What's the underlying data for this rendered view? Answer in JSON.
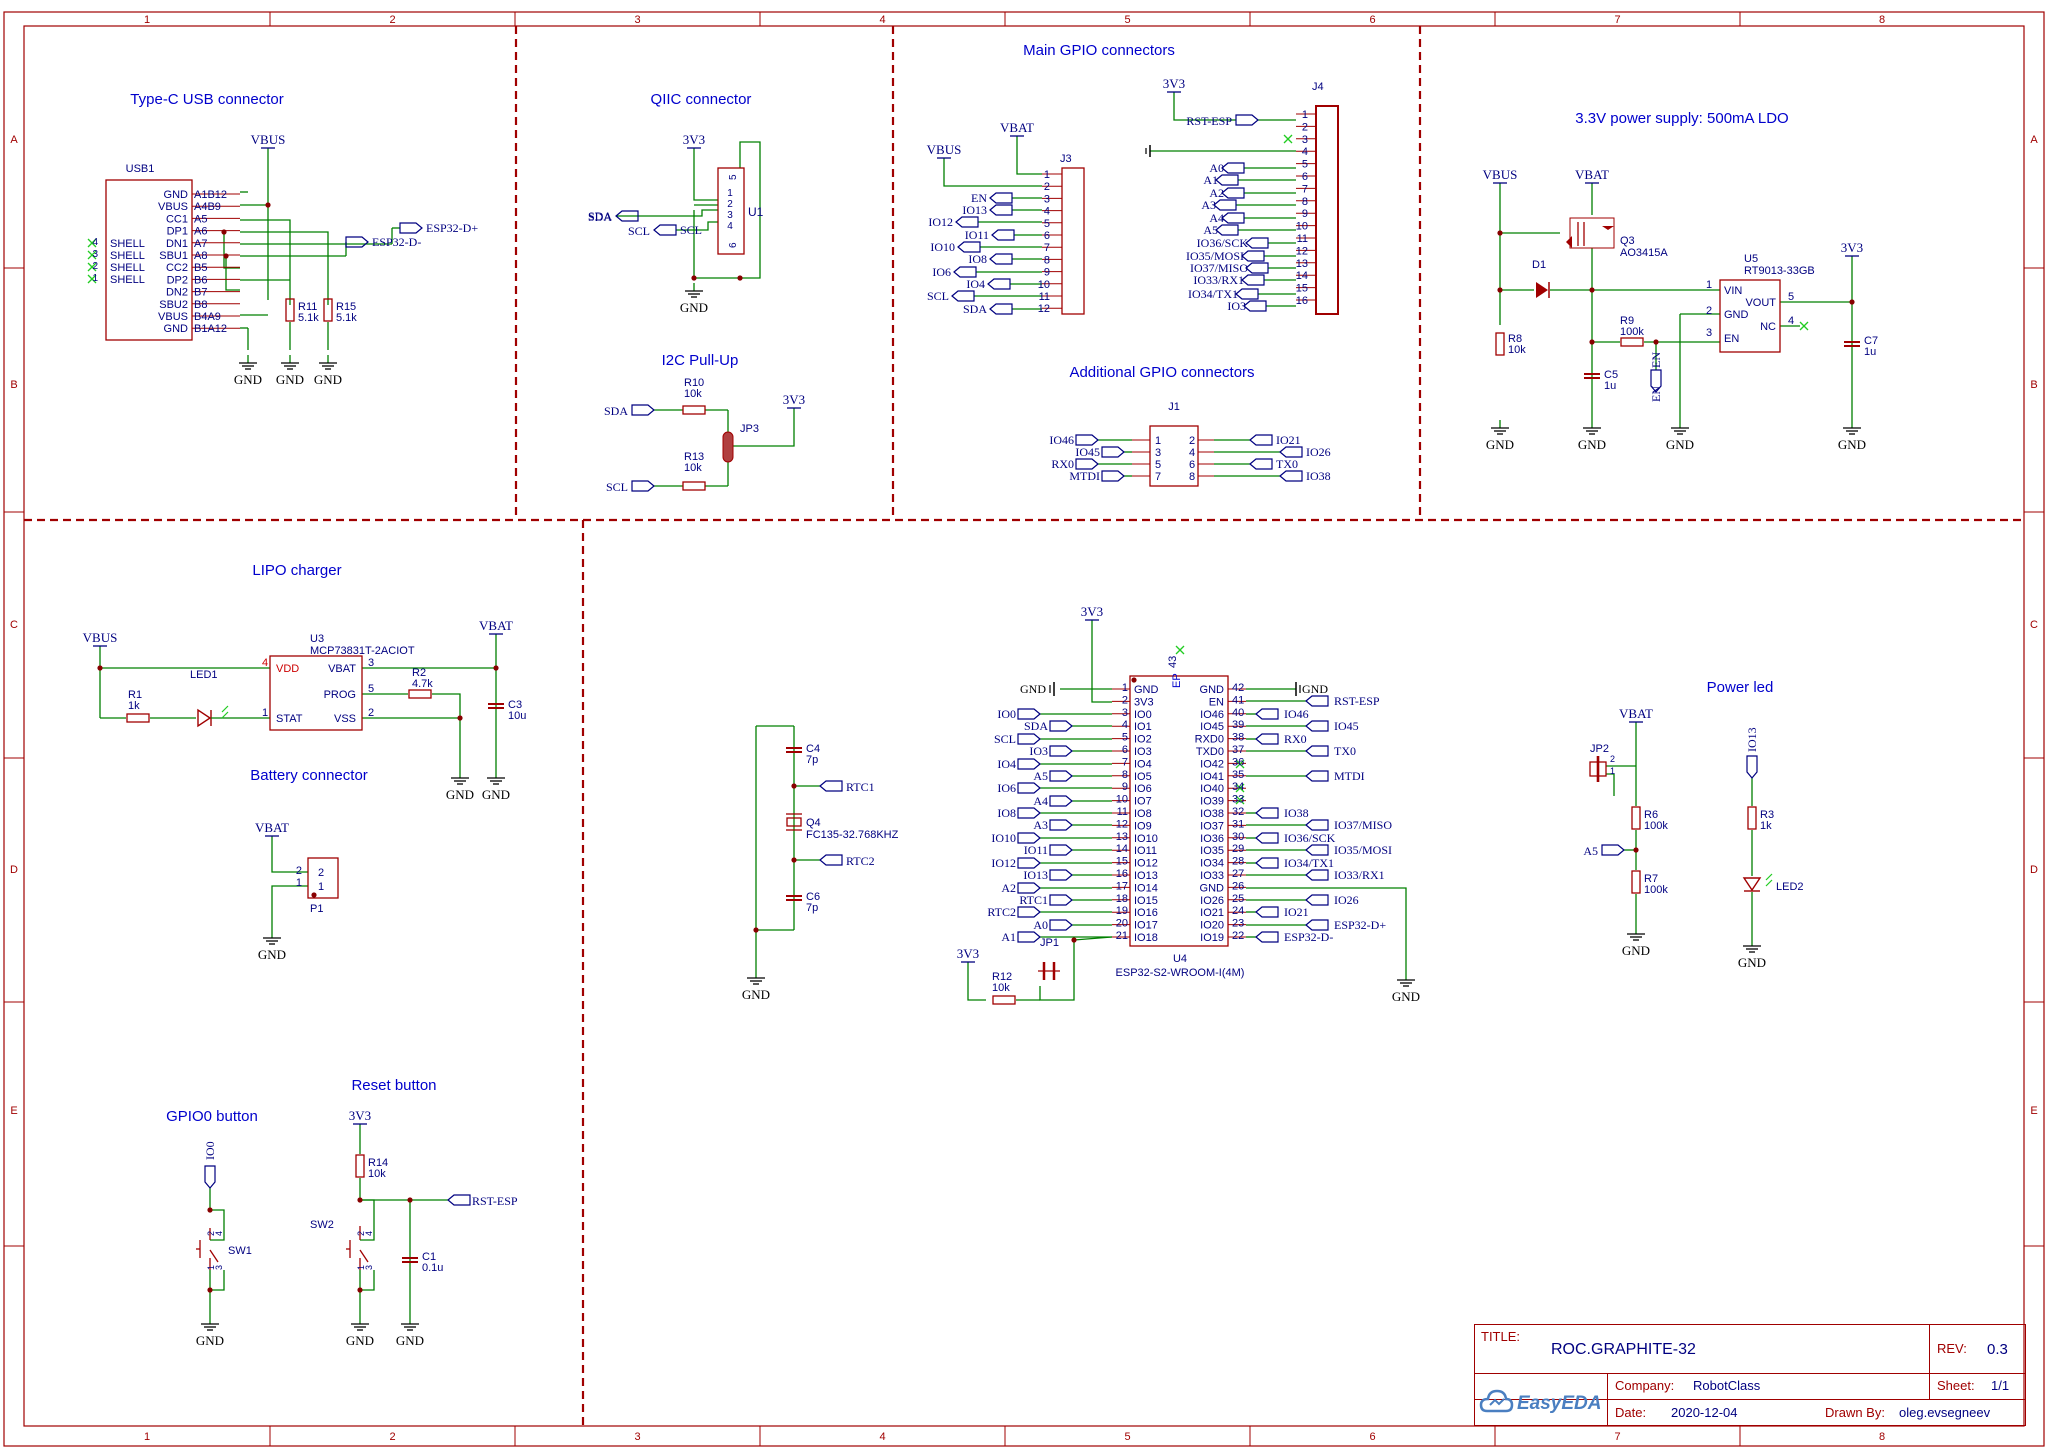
{
  "sheet": {
    "col_labels": [
      "1",
      "2",
      "3",
      "4",
      "5",
      "6",
      "7",
      "8"
    ],
    "row_labels": [
      "A",
      "B",
      "C",
      "D",
      "E"
    ]
  },
  "sections": {
    "usb": "Type-C USB connector",
    "qiic": "QIIC connector",
    "i2c_pullup": "I2C Pull-Up",
    "main_gpio": "Main GPIO connectors",
    "additional_gpio": "Additional GPIO connectors",
    "ldo": "3.3V power supply: 500mA LDO",
    "lipo": "LIPO charger",
    "battery": "Battery connector",
    "gpio0": "GPIO0 button",
    "reset": "Reset button",
    "power_led": "Power led"
  },
  "usb1": {
    "ref": "USB1",
    "left_pins": [
      "SHELL",
      "SHELL",
      "SHELL",
      "SHELL"
    ],
    "left_nums": [
      "4",
      "3",
      "2",
      "1"
    ],
    "inner_pins": [
      "GND",
      "VBUS",
      "CC1",
      "DP1",
      "DN1",
      "SBU1",
      "CC2",
      "DP2",
      "DN2",
      "SBU2",
      "VBUS",
      "GND"
    ],
    "outer_pins": [
      "A1B12",
      "A4B9",
      "A5",
      "A6",
      "A7",
      "A8",
      "B5",
      "B6",
      "B7",
      "B8",
      "B4A9",
      "B1A12"
    ],
    "r11": {
      "ref": "R11",
      "val": "5.1k"
    },
    "r15": {
      "ref": "R15",
      "val": "5.1k"
    },
    "dp_net": "ESP32-D+",
    "dm_net": "ESP32-D-"
  },
  "qiic": {
    "ref": "U1",
    "pins": [
      "1",
      "2",
      "3",
      "4"
    ],
    "pins_rot": [
      "5",
      "6"
    ],
    "sda": "SDA",
    "scl": "SCL"
  },
  "pullup": {
    "r10": {
      "ref": "R10",
      "val": "10k"
    },
    "r13": {
      "ref": "R13",
      "val": "10k"
    },
    "jp3": "JP3",
    "sda": "SDA",
    "scl": "SCL"
  },
  "j3": {
    "ref": "J3",
    "pins": [
      "1",
      "2",
      "3",
      "4",
      "5",
      "6",
      "7",
      "8",
      "9",
      "10",
      "11",
      "12"
    ],
    "nets": [
      "EN",
      "IO13",
      "IO12",
      "IO11",
      "IO10",
      "IO8",
      "IO6",
      "IO4",
      "SCL",
      "SDA"
    ]
  },
  "j4": {
    "ref": "J4",
    "pins": [
      "1",
      "2",
      "3",
      "4",
      "5",
      "6",
      "7",
      "8",
      "9",
      "10",
      "11",
      "12",
      "13",
      "14",
      "15",
      "16"
    ],
    "nets": [
      "RST-ESP",
      "A0",
      "A1",
      "A2",
      "A3",
      "A4",
      "A5",
      "IO36/SCK",
      "IO35/MOSI",
      "IO37/MISO",
      "IO33/RX1",
      "IO34/TX1",
      "IO3"
    ]
  },
  "j1": {
    "ref": "J1",
    "left_pins": [
      "1",
      "3",
      "5",
      "7"
    ],
    "right_pins": [
      "2",
      "4",
      "6",
      "8"
    ],
    "left_nets": [
      "IO46",
      "IO45",
      "RX0",
      "MTDI"
    ],
    "right_nets": [
      "IO21",
      "IO26",
      "TX0",
      "IO38"
    ]
  },
  "ldo": {
    "d1": "D1",
    "q3": {
      "ref": "Q3",
      "val": "AO3415A"
    },
    "u5": {
      "ref": "U5",
      "val": "RT9013-33GB",
      "pins": [
        "VIN",
        "GND",
        "EN",
        "VOUT",
        "NC"
      ],
      "nums": [
        "1",
        "2",
        "3",
        "5",
        "4"
      ]
    },
    "r8": {
      "ref": "R8",
      "val": "10k"
    },
    "r9": {
      "ref": "R9",
      "val": "100k"
    },
    "c5": {
      "ref": "C5",
      "val": "1u"
    },
    "c7": {
      "ref": "C7",
      "val": "1u"
    },
    "en": "EN"
  },
  "lipo": {
    "u3": {
      "ref": "U3",
      "val": "MCP73831T-2ACIOT",
      "pins": [
        "VDD",
        "STAT",
        "VBAT",
        "PROG",
        "VSS"
      ],
      "nums": [
        "4",
        "1",
        "3",
        "5",
        "2"
      ]
    },
    "r1": {
      "ref": "R1",
      "val": "1k"
    },
    "led1": "LED1",
    "r2": {
      "ref": "R2",
      "val": "4.7k"
    },
    "c3": {
      "ref": "C3",
      "val": "10u"
    }
  },
  "battery": {
    "ref": "P1",
    "nums": [
      "2",
      "1"
    ],
    "pins": [
      "2",
      "1"
    ]
  },
  "gpio0": {
    "sw": "SW1",
    "net": "IO0"
  },
  "reset": {
    "sw": "SW2",
    "r14": {
      "ref": "R14",
      "val": "10k"
    },
    "c1": {
      "ref": "C1",
      "val": "0.1u"
    },
    "net": "RST-ESP"
  },
  "crystal": {
    "c4": {
      "ref": "C4",
      "val": "7p"
    },
    "c6": {
      "ref": "C6",
      "val": "7p"
    },
    "q4": {
      "ref": "Q4",
      "val": "FC135-32.768KHZ"
    },
    "rtc1": "RTC1",
    "rtc2": "RTC2"
  },
  "u4": {
    "ref": "U4",
    "val": "ESP32-S2-WROOM-I(4M)",
    "left_nums": [
      "1",
      "2",
      "3",
      "4",
      "5",
      "6",
      "7",
      "8",
      "9",
      "10",
      "11",
      "12",
      "13",
      "14",
      "15",
      "16",
      "17",
      "18",
      "19",
      "20",
      "21"
    ],
    "left_names": [
      "GND",
      "3V3",
      "IO0",
      "IO1",
      "IO2",
      "IO3",
      "IO4",
      "IO5",
      "IO6",
      "IO7",
      "IO8",
      "IO9",
      "IO10",
      "IO11",
      "IO12",
      "IO13",
      "IO14",
      "IO15",
      "IO16",
      "IO17",
      "IO18"
    ],
    "right_nums": [
      "42",
      "41",
      "40",
      "39",
      "38",
      "37",
      "36",
      "35",
      "34",
      "33",
      "32",
      "31",
      "30",
      "29",
      "28",
      "27",
      "26",
      "25",
      "24",
      "23",
      "22"
    ],
    "right_names": [
      "GND",
      "EN",
      "IO46",
      "IO45",
      "RXD0",
      "TXD0",
      "IO42",
      "IO41",
      "IO40",
      "IO39",
      "IO38",
      "IO37",
      "IO36",
      "IO35",
      "IO34",
      "IO33",
      "GND",
      "IO26",
      "IO21",
      "IO20",
      "IO19"
    ],
    "ep": "EP",
    "ep_num": "43",
    "left_nets": [
      "IO0",
      "SDA",
      "SCL",
      "IO3",
      "IO4",
      "A5",
      "IO6",
      "A4",
      "IO8",
      "A3",
      "IO10",
      "IO11",
      "IO12",
      "IO13",
      "A2",
      "RTC1",
      "RTC2",
      "A0",
      "A1"
    ],
    "right_nets": [
      "RST-ESP",
      "IO46",
      "IO45",
      "RX0",
      "TX0",
      "MTDI",
      "IO38",
      "IO37/MISO",
      "IO36/SCK",
      "IO35/MOSI",
      "IO34/TX1",
      "IO33/RX1",
      "IO26",
      "IO21",
      "ESP32-D+",
      "ESP32-D-"
    ],
    "r12": {
      "ref": "R12",
      "val": "10k"
    },
    "jp1": "JP1"
  },
  "pled": {
    "jp2": "JP2",
    "r6": {
      "ref": "R6",
      "val": "100k"
    },
    "r7": {
      "ref": "R7",
      "val": "100k"
    },
    "a5": "A5",
    "r3": {
      "ref": "R3",
      "val": "1k"
    },
    "led2": "LED2",
    "io13": "IO13"
  },
  "power": {
    "vbus": "VBUS",
    "vbat": "VBAT",
    "v3": "3V3",
    "gnd": "GND"
  },
  "title_block": {
    "title_label": "TITLE:",
    "title": "ROC.GRAPHITE-32",
    "rev_label": "REV:",
    "rev": "0.3",
    "company_label": "Company:",
    "company": "RobotClass",
    "sheet_label": "Sheet:",
    "sheet": "1/1",
    "date_label": "Date:",
    "date": "2020-12-04",
    "drawn_label": "Drawn By:",
    "drawn": "oleg.evsegneev",
    "logo": "EasyEDA"
  }
}
